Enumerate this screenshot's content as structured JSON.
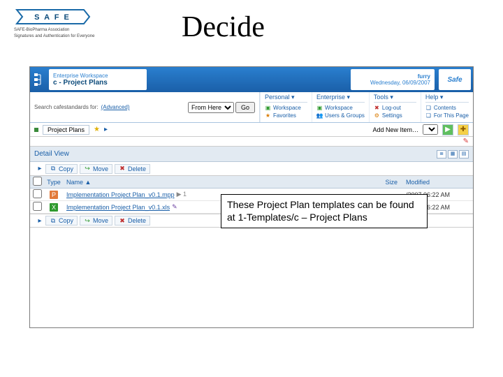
{
  "slide": {
    "title": "Decide",
    "logo_main": "S A F E",
    "logo_sub1": "SAFE-BioPharma Association",
    "logo_sub2": "Signatures and Authentication for Everyone"
  },
  "banner": {
    "workspace_label": "Enterprise Workspace",
    "workspace_name": "c - Project Plans",
    "user": "furry",
    "date": "Wednesday, 06/09/2007",
    "brand": "Safe"
  },
  "search": {
    "label": "Search cafestandards for:",
    "advanced": "(Advanced)",
    "scope": "From Here",
    "go": "Go"
  },
  "menus": {
    "personal": {
      "title": "Personal ▾",
      "items": [
        "Workspace",
        "Favorites"
      ]
    },
    "enterprise": {
      "title": "Enterprise ▾",
      "items": [
        "Workspace",
        "Users & Groups"
      ]
    },
    "tools": {
      "title": "Tools ▾",
      "items": [
        "Log-out",
        "Settings"
      ]
    },
    "help": {
      "title": "Help ▾",
      "items": [
        "Contents",
        "For This Page"
      ]
    }
  },
  "toolbar": {
    "breadcrumb": "Project Plans",
    "add_new": "Add New Item…"
  },
  "detail": {
    "title": "Detail View"
  },
  "actions": {
    "copy": "Copy",
    "move": "Move",
    "delete": "Delete"
  },
  "columns": {
    "type": "Type",
    "name": "Name ▲",
    "size": "Size",
    "modified": "Modified"
  },
  "rows": [
    {
      "name": "Implementation Project Plan_v0.1.mpp",
      "ext": "mpp",
      "flag": "▶ 1",
      "size": "",
      "modified": "/2007 06:22 AM"
    },
    {
      "name": "Implementation Project Plan_v0.1.xls",
      "ext": "xls",
      "flag": "✎",
      "size": "",
      "modified": "/2007 06:22 AM"
    }
  ],
  "callout": {
    "text": "These Project Plan templates can be found at 1-Templates/c – Project Plans"
  }
}
